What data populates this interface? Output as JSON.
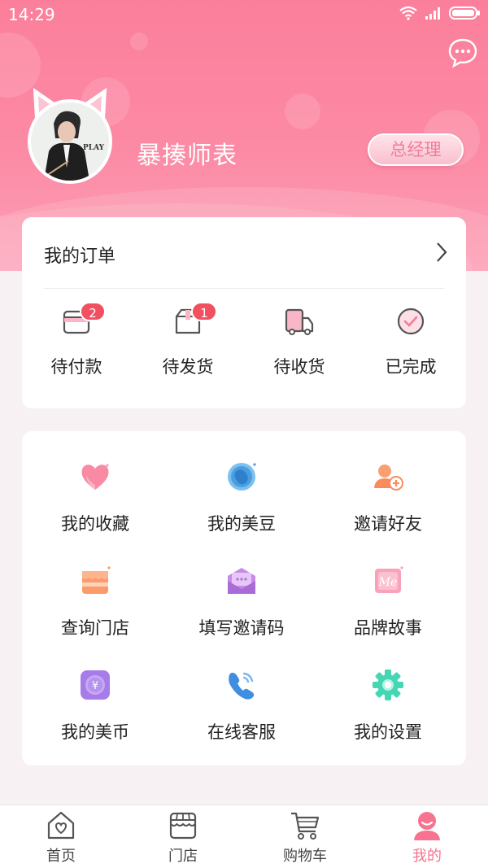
{
  "status_bar": {
    "time": "14:29"
  },
  "profile": {
    "username": "暴揍师表",
    "role": "总经理",
    "avatar_text": "PLAY"
  },
  "orders": {
    "title": "我的订单",
    "items": [
      {
        "label": "待付款",
        "badge": "2",
        "icon": "wallet-icon"
      },
      {
        "label": "待发货",
        "badge": "1",
        "icon": "package-icon"
      },
      {
        "label": "待收货",
        "badge": "",
        "icon": "truck-icon"
      },
      {
        "label": "已完成",
        "badge": "",
        "icon": "check-circle-icon"
      }
    ]
  },
  "menu": {
    "items": [
      {
        "label": "我的收藏",
        "icon": "heart-icon"
      },
      {
        "label": "我的美豆",
        "icon": "bean-icon"
      },
      {
        "label": "邀请好友",
        "icon": "add-friend-icon"
      },
      {
        "label": "查询门店",
        "icon": "store-icon"
      },
      {
        "label": "填写邀请码",
        "icon": "envelope-icon"
      },
      {
        "label": "品牌故事",
        "icon": "me-brand-icon",
        "icon_text": "Me"
      },
      {
        "label": "我的美币",
        "icon": "coin-icon",
        "icon_text": "¥"
      },
      {
        "label": "在线客服",
        "icon": "phone-icon"
      },
      {
        "label": "我的设置",
        "icon": "gear-icon"
      }
    ]
  },
  "bottom_nav": {
    "items": [
      {
        "label": "首页",
        "icon": "home-icon"
      },
      {
        "label": "门店",
        "icon": "shop-icon"
      },
      {
        "label": "购物车",
        "icon": "cart-icon"
      },
      {
        "label": "我的",
        "icon": "profile-icon",
        "active": true
      }
    ]
  },
  "colors": {
    "brand": "#fb7f9b",
    "badge": "#f0505f",
    "active_nav": "#f7738f"
  }
}
